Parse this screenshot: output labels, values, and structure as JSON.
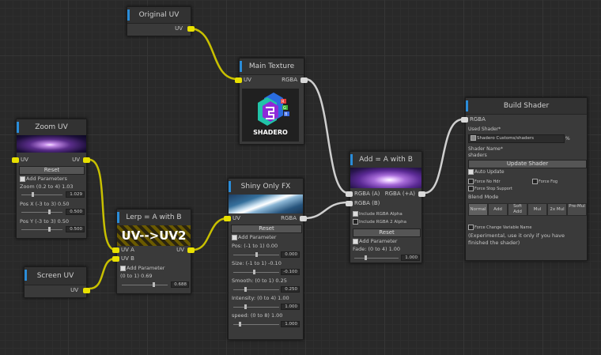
{
  "nodes": {
    "original_uv": {
      "title": "Original UV",
      "out": "UV"
    },
    "main_texture": {
      "title": "Main Texture",
      "in": "UV",
      "out": "RGBA",
      "logo_text": "SHADERO",
      "logo_letters": [
        "R",
        "G",
        "B"
      ]
    },
    "zoom_uv": {
      "title": "Zoom UV",
      "in": "UV",
      "out": "UV",
      "reset": "Reset",
      "add_params": "Add Parameters",
      "params": [
        {
          "label": "Zoom (0.2 to 4) 1.03",
          "value": "1.029"
        },
        {
          "label": "Pos X (-3 to 3) 0.50",
          "value": "0.500"
        },
        {
          "label": "Pos Y (-3 to 3) 0.50",
          "value": "0.500"
        }
      ]
    },
    "lerp": {
      "title": "Lerp = A with B",
      "banner": "UV-->UV2",
      "in_a": "UV A",
      "in_b": "UV B",
      "out": "UV",
      "add_params": "Add Parameter",
      "param_label": "(0 to 1) 0.69",
      "param_value": "0.688"
    },
    "screen_uv": {
      "title": "Screen UV",
      "out": "UV"
    },
    "shiny": {
      "title": "Shiny Only FX",
      "in": "UV",
      "out": "RGBA",
      "reset": "Reset",
      "add_params": "Add Parameter",
      "params": [
        {
          "label": "Pos: (-1 to 1) 0.00",
          "value": "0.000"
        },
        {
          "label": "Size: (-1 to 1) -0.10",
          "value": "-0.100"
        },
        {
          "label": "Smooth: (0 to 1) 0.25",
          "value": "0.250"
        },
        {
          "label": "Intensity: (0 to 4) 1.00",
          "value": "1.000"
        },
        {
          "label": "speed: (0 to 8) 1.00",
          "value": "1.000"
        }
      ]
    },
    "add": {
      "title": "Add = A with B",
      "in_a": "RGBA (A)",
      "in_b": "RGBA (B)",
      "out": "RGBA (+A)",
      "include_a": "Include RGBA Alpha",
      "include_b": "Include RGBA 2 Alpha",
      "reset": "Reset",
      "add_params": "Add Parameter",
      "param_label": "Fade: (0 to 4) 1.00",
      "param_value": "1.000"
    },
    "build": {
      "title": "Build Shader",
      "in": "RGBA",
      "used_shader_label": "Used Shader*",
      "used_shader_value": "Shadero Customs/shaders",
      "pct": "%",
      "shader_name_label": "Shader Name*",
      "shader_name_value": "shaders",
      "update_btn": "Update Shader",
      "auto_update": "Auto Update",
      "force_no_hdr": "Force No Hdr",
      "force_fog": "Force Fog",
      "force_stop_support": "Force Stop Support",
      "blend_mode": "Blend Mode",
      "blend_tabs": [
        "Normal",
        "Add",
        "Soft Add",
        "Mul",
        "2x Mul",
        "Pre-Mul"
      ],
      "force_change": "Force Change Variable Name",
      "note": "(Experimental, use it only if you have finished the shader)"
    }
  }
}
